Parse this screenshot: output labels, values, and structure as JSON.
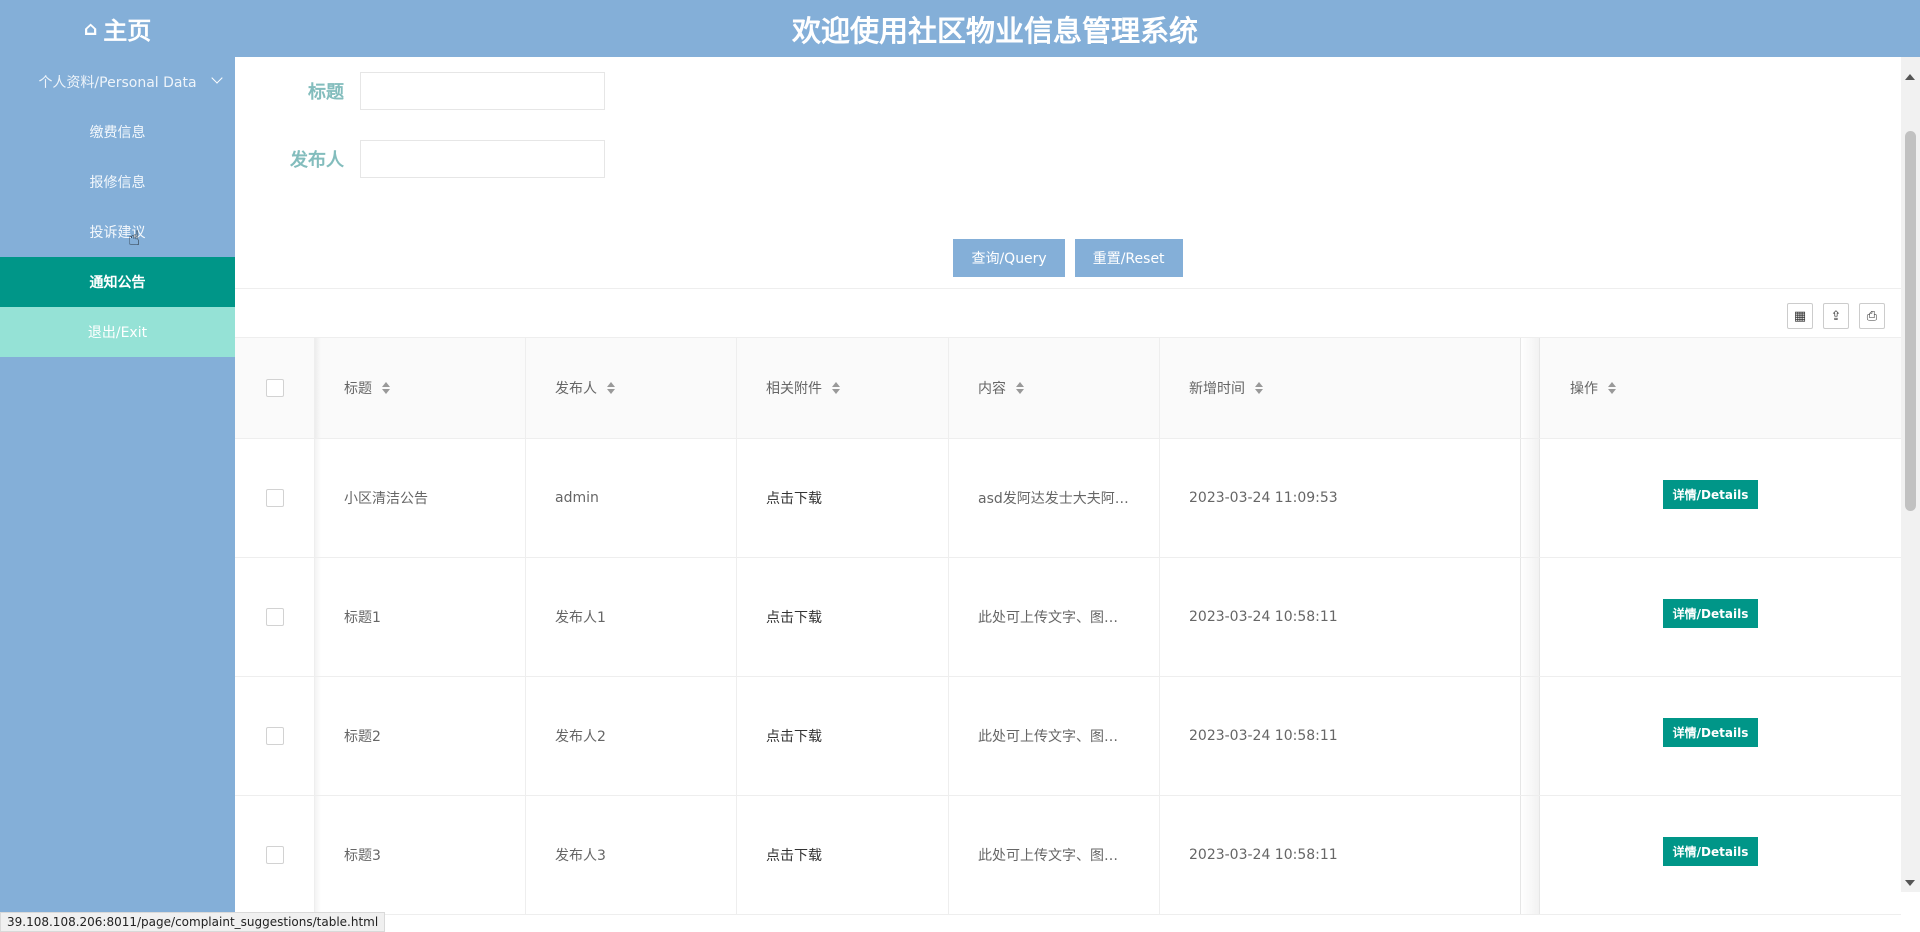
{
  "header": {
    "home_label": "主页",
    "home_icon": "home-icon",
    "title": "欢迎使用社区物业信息管理系统"
  },
  "sidebar": {
    "items": [
      {
        "label": "个人资料/Personal Data"
      },
      {
        "label": "缴费信息"
      },
      {
        "label": "报修信息"
      },
      {
        "label": "投诉建议"
      },
      {
        "label": "通知公告"
      },
      {
        "label": "退出/Exit"
      }
    ]
  },
  "search": {
    "title_label": "标题",
    "title_value": "",
    "publisher_label": "发布人",
    "publisher_value": "",
    "query_button": "查询/Query",
    "reset_button": "重置/Reset"
  },
  "toolbar": {
    "icons": [
      "columns-filter-icon",
      "export-icon",
      "print-icon"
    ]
  },
  "table": {
    "columns": [
      "标题",
      "发布人",
      "相关附件",
      "内容",
      "新增时间",
      "操作"
    ],
    "rows": [
      {
        "title": "小区清洁公告",
        "publisher": "admin",
        "attachment": "点击下载",
        "content": "asd发阿达发士大夫阿…",
        "time": "2023-03-24 11:09:53",
        "action": "详情/Details"
      },
      {
        "title": "标题1",
        "publisher": "发布人1",
        "attachment": "点击下载",
        "content": "此处可上传文字、图…",
        "time": "2023-03-24 10:58:11",
        "action": "详情/Details"
      },
      {
        "title": "标题2",
        "publisher": "发布人2",
        "attachment": "点击下载",
        "content": "此处可上传文字、图…",
        "time": "2023-03-24 10:58:11",
        "action": "详情/Details"
      },
      {
        "title": "标题3",
        "publisher": "发布人3",
        "attachment": "点击下载",
        "content": "此处可上传文字、图…",
        "time": "2023-03-24 10:58:11",
        "action": "详情/Details"
      }
    ]
  },
  "status_bar": {
    "url": "39.108.108.206:8011/page/complaint_suggestions/table.html"
  }
}
